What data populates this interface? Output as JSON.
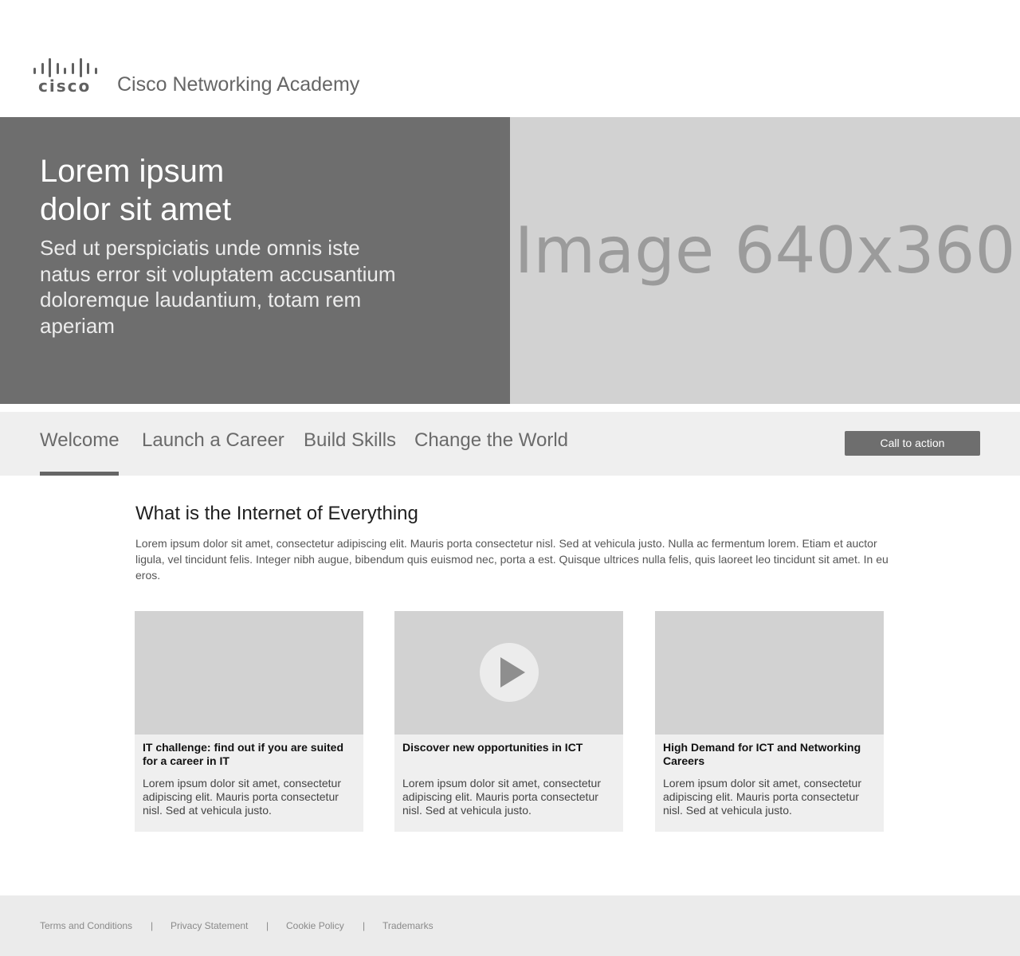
{
  "header": {
    "logo_text": "cisco",
    "site_title": "Cisco Networking Academy"
  },
  "hero": {
    "title_line1": "Lorem ipsum",
    "title_line2": "dolor sit amet",
    "subtitle": "Sed ut perspiciatis unde omnis iste natus error sit voluptatem accusantium doloremque laudantium, totam rem aperiam",
    "image_placeholder": "Image 640x360"
  },
  "tabs": [
    {
      "label": "Welcome",
      "active": true
    },
    {
      "label": "Launch a Career",
      "active": false
    },
    {
      "label": "Build Skills",
      "active": false
    },
    {
      "label": "Change the World",
      "active": false
    }
  ],
  "cta_label": "Call to action",
  "section": {
    "title": "What is the Internet of Everything",
    "body": "Lorem ipsum dolor sit amet, consectetur adipiscing elit. Mauris porta consectetur nisl. Sed at vehicula justo. Nulla ac fermentum lorem. Etiam et auctor ligula, vel tincidunt felis. Integer nibh augue, bibendum quis euismod nec, porta a est. Quisque ultrices nulla felis, quis laoreet leo tincidunt sit amet. In eu eros."
  },
  "cards": [
    {
      "title": "IT challenge: find out if you are suited for a career in IT",
      "text": "Lorem ipsum dolor sit amet, consectetur adipiscing elit. Mauris porta consectetur nisl. Sed at vehicula justo.",
      "media": "image"
    },
    {
      "title": "Discover new opportunities in ICT",
      "text": "Lorem ipsum dolor sit amet, consectetur adipiscing elit. Mauris porta consectetur nisl. Sed at vehicula justo.",
      "media": "video",
      "icon": "play-icon"
    },
    {
      "title": "High Demand for ICT and Networking Careers",
      "text": "Lorem ipsum dolor sit amet, consectetur adipiscing elit. Mauris porta consectetur nisl. Sed at vehicula justo.",
      "media": "image"
    }
  ],
  "footer": {
    "links": [
      "Terms and Conditions",
      "Privacy Statement",
      "Cookie Policy",
      "Trademarks"
    ],
    "separator": "|"
  },
  "colors": {
    "hero_dark": "#6e6e6e",
    "placeholder_gray": "#d2d2d2",
    "tabbar_bg": "#efefef",
    "footer_bg": "#ebebeb"
  }
}
